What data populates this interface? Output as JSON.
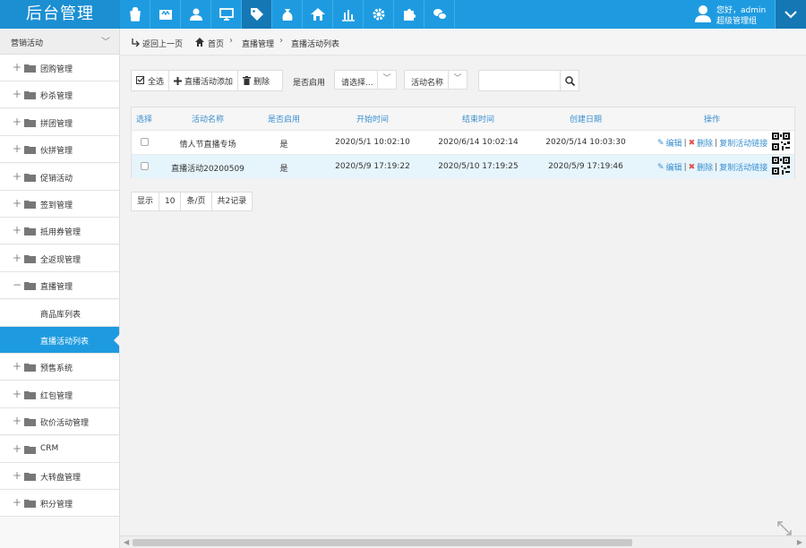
{
  "app": {
    "title": "后台管理"
  },
  "topnav": [
    {
      "icon": "shopping-bag-icon"
    },
    {
      "icon": "store-icon"
    },
    {
      "icon": "user-icon"
    },
    {
      "icon": "monitor-icon"
    },
    {
      "icon": "tag-icon",
      "active": true
    },
    {
      "icon": "money-bag-icon"
    },
    {
      "icon": "home-icon"
    },
    {
      "icon": "bar-chart-icon"
    },
    {
      "icon": "gear-icon"
    },
    {
      "icon": "puzzle-icon"
    },
    {
      "icon": "chat-icon"
    }
  ],
  "user": {
    "greeting": "您好，admin",
    "role": "超级管理组"
  },
  "sidebar": {
    "section_title": "营销活动",
    "items": [
      {
        "label": "团购管理",
        "expanded": false
      },
      {
        "label": "秒杀管理",
        "expanded": false
      },
      {
        "label": "拼团管理",
        "expanded": false
      },
      {
        "label": "伙拼管理",
        "expanded": false
      },
      {
        "label": "促销活动",
        "expanded": false
      },
      {
        "label": "签到管理",
        "expanded": false
      },
      {
        "label": "抵用券管理",
        "expanded": false
      },
      {
        "label": "全返现管理",
        "expanded": false
      },
      {
        "label": "直播管理",
        "expanded": true
      },
      {
        "label": "预售系统",
        "expanded": false
      },
      {
        "label": "红包管理",
        "expanded": false
      },
      {
        "label": "砍价活动管理",
        "expanded": false
      },
      {
        "label": "CRM",
        "expanded": false
      },
      {
        "label": "大转盘管理",
        "expanded": false
      },
      {
        "label": "积分管理",
        "expanded": false
      }
    ],
    "subitems": [
      {
        "label": "商品库列表"
      },
      {
        "label": "直播活动列表",
        "active": true
      }
    ]
  },
  "breadcrumb": {
    "back": "返回上一页",
    "home": "首页",
    "level1": "直播管理",
    "level2": "直播活动列表"
  },
  "toolbar": {
    "select_all": "全选",
    "add": "直播活动添加",
    "delete": "删除",
    "enabled_label": "是否启用",
    "enabled_select": "请选择...",
    "field_select": "活动名称",
    "search_value": ""
  },
  "table": {
    "headers": [
      "选择",
      "活动名称",
      "是否启用",
      "开始时间",
      "结束时间",
      "创建日期",
      "操作"
    ],
    "rows": [
      {
        "name": "情人节直播专场",
        "enabled": "是",
        "start": "2020/5/1 10:02:10",
        "end": "2020/6/14 10:02:14",
        "created": "2020/5/14 10:03:30",
        "selected": false,
        "highlight": false
      },
      {
        "name": "直播活动20200509",
        "enabled": "是",
        "start": "2020/5/9 17:19:22",
        "end": "2020/5/10 17:19:25",
        "created": "2020/5/9 17:19:46",
        "selected": false,
        "highlight": true
      }
    ],
    "actions": {
      "edit": "编辑",
      "delete": "删除",
      "copy": "复制活动链接"
    }
  },
  "pager": {
    "show": "显示",
    "page_size": "10",
    "per_page": "条/页",
    "total": "共2记录"
  },
  "colors": {
    "accent": "#1e9be0",
    "accent_dark": "#1578b4",
    "highlight_row": "#e6f4fb",
    "link": "#3a8fd0",
    "delete_red": "#d9534f"
  }
}
